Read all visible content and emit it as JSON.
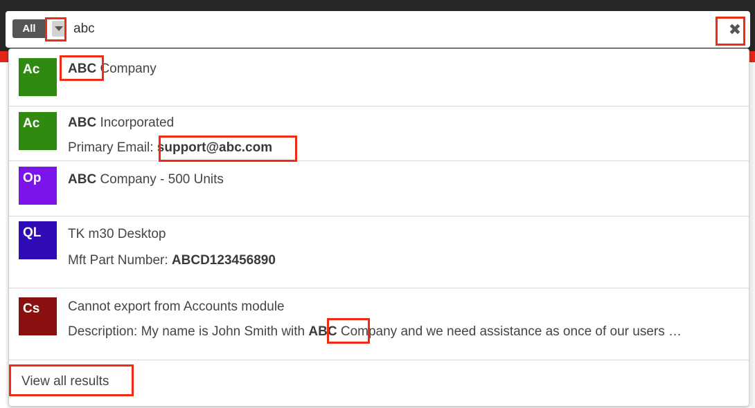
{
  "search": {
    "module_filter": "All",
    "query": "abc",
    "clear_icon": "close-icon",
    "toggle_icon": "chevron-down-icon"
  },
  "colors": {
    "topbar": "#262626",
    "accent": "#e3261b",
    "annotation": "#f12b12",
    "account": "#2f8a0f",
    "opportunity": "#7a14e8",
    "quoted_line_item": "#2f0bb5",
    "case": "#8a0f0f"
  },
  "results": [
    {
      "avatar": "Ac",
      "module": "account",
      "title_match": "ABC",
      "title_rest": " Company"
    },
    {
      "avatar": "Ac",
      "module": "account",
      "title_match": "ABC",
      "title_rest": " Incorporated",
      "detail_label": "Primary Email: ",
      "detail_value": "support@abc.com"
    },
    {
      "avatar": "Op",
      "module": "opportunity",
      "title_match": "ABC",
      "title_rest": " Company - 500 Units"
    },
    {
      "avatar": "QL",
      "module": "quoted_line_item",
      "title": "TK m30 Desktop",
      "detail_label": "Mft Part Number: ",
      "detail_value": "ABCD123456890"
    },
    {
      "avatar": "Cs",
      "module": "case",
      "title": "Cannot export from Accounts module",
      "detail_label": "Description: My name is John Smith with ",
      "detail_match": "ABC",
      "detail_rest": " Company and we need assistance as once of our users …"
    }
  ],
  "footer": {
    "view_all_label": "View all results"
  }
}
